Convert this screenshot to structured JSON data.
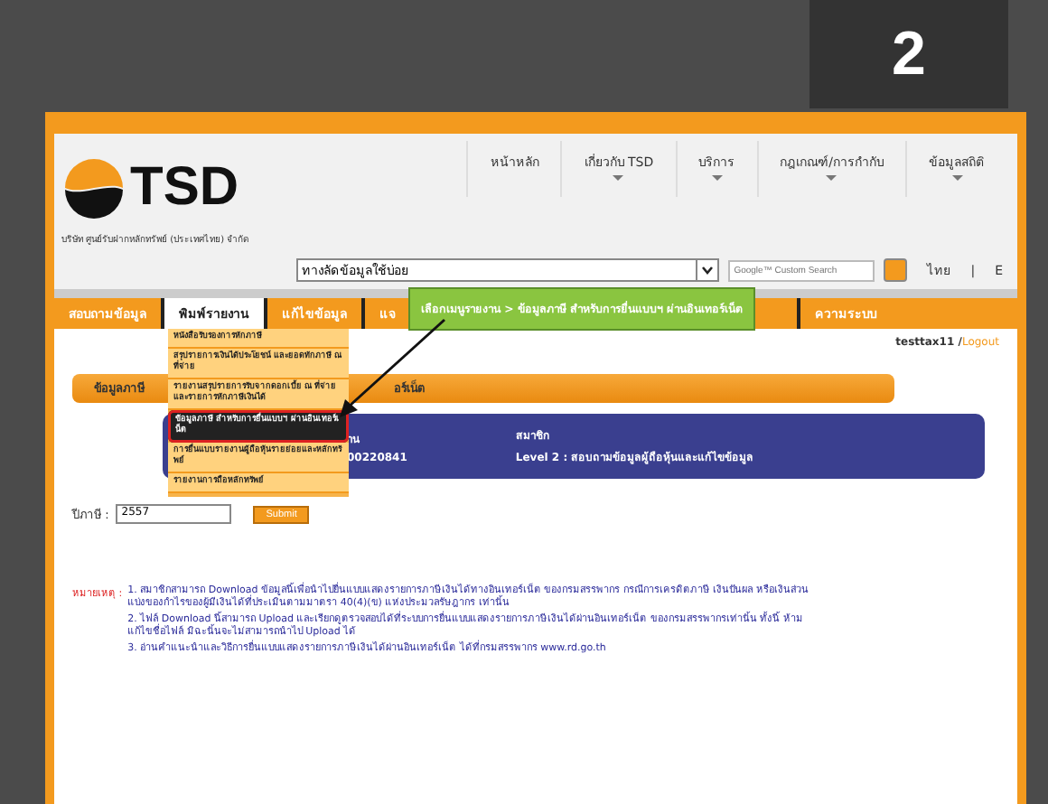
{
  "slide_badge": "2",
  "header": {
    "company": "บริษัท ศูนย์รับฝากหลักทรัพย์ (ประเทศไทย) จำกัด",
    "logo_text": "TSD",
    "nav": [
      {
        "label": "หน้าหลัก",
        "has_caret": false
      },
      {
        "label": "เกี่ยวกับ TSD",
        "has_caret": true
      },
      {
        "label": "บริการ",
        "has_caret": true
      },
      {
        "label": "กฎเกณฑ์/การกำกับ",
        "has_caret": true
      },
      {
        "label": "ข้อมูลสถิติ",
        "has_caret": true
      }
    ],
    "shortcut_select": "ทางลัดข้อมูลใช้บ่อย",
    "search": {
      "placeholder": "Google™ Custom Search"
    },
    "languages": [
      "ไทย",
      "|",
      "E"
    ]
  },
  "menu": [
    {
      "label": "สอบถามข้อมูล",
      "selected": false
    },
    {
      "label": "พิมพ์รายงาน",
      "selected": true
    },
    {
      "label": "แก้ไขข้อมูล",
      "selected": false
    },
    {
      "label": "แจ",
      "selected": false
    },
    {
      "label": "ความระบบ",
      "selected": false
    }
  ],
  "dropdown": [
    {
      "label": "หนังสือรับรองการหักภาษี",
      "selected": false
    },
    {
      "label": "สรุปรายการเงินได้ประโยชน์ และยอดทักภาษี ณ ที่จ่าย",
      "selected": false
    },
    {
      "label": "รายงานสรุปรายการรับจากดอกเบี้ย ณ ที่จ่าย และรายการหักภาษีเงินได้",
      "selected": false
    },
    {
      "label": "ข้อมูลภาษี สำหรับการยื่นแบบฯ ผ่านอินเทอร์เน็ต",
      "selected": true
    },
    {
      "label": "การยื่นแบบรายงานผู้ถือหุ้นรายย่อยและหลักทรัพย์",
      "selected": false
    },
    {
      "label": "รายงานการถือหลักทรัพย์",
      "selected": false
    }
  ],
  "callout": "เลือกเมนูรายงาน > ข้อมูลภาษี สำหรับการยื่นแบบฯ ผ่านอินเทอร์เน็ต",
  "user": {
    "name": "testtax11",
    "separator": "/",
    "logout": "Logout"
  },
  "section_title": {
    "left": "ข้อมูลภาษี",
    "right": "อร์เน็ต"
  },
  "account_card": {
    "left_lines": [
      "าน",
      "00220841"
    ],
    "right_lines": [
      "สมาชิก",
      "Level 2  :  สอบถามข้อมูลผู้ถือหุ้นและแก้ไขข้อมูล"
    ]
  },
  "year": {
    "label": "ปีภาษี :",
    "value": "2557",
    "submit": "Submit"
  },
  "notes": {
    "label": "หมายเหตุ :",
    "items": [
      "1. สมาชิกสามารถ Download ข้อมูลนี้เพื่อนำไปยื่นแบบแสดงรายการภาษีเงินได้ทางอินเทอร์เน็ต ของกรมสรรพากร กรณีการเครดิตภาษี เงินปันผล หรือเงินส่วนแบ่งของกำไรของผู้มีเงินได้ที่ประเมินตามมาตรา 40(4)(ข) แห่งประมวลรัษฎากร เท่านั้น",
      "2. ไฟล์ Download นี้สามารถ Upload และเรียกดูตรวจสอบได้ที่ระบบการยื่นแบบแสดงรายการภาษีเงินได้ผ่านอินเทอร์เน็ต ของกรมสรรพากรเท่านั้น ทั้งนี้ ห้ามแก้ไขชื่อไฟล์ มิฉะนั้นจะไม่สามารถนำไป Upload ได้",
      "3. อ่านคำแนะนำและวิธีการยื่นแบบแสดงรายการภาษีเงินได้ผ่านอินเทอร์เน็ต ได้ที่กรมสรรพากร www.rd.go.th"
    ]
  }
}
